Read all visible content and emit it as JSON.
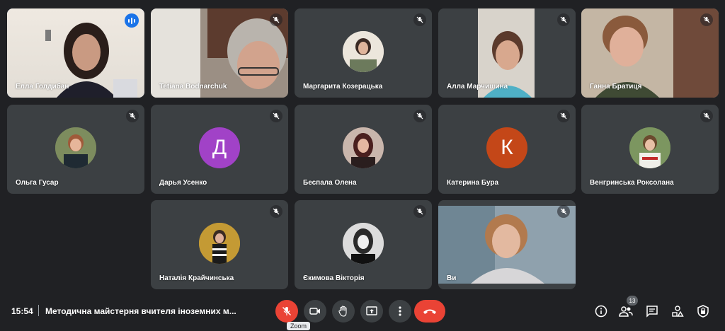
{
  "participants": [
    {
      "name": "Елла Голдибан",
      "type": "video",
      "speaking": true,
      "bg": "#e9e4dc"
    },
    {
      "name": "Tetiana Bodnarchuk",
      "type": "video",
      "bg": "#8d8b87"
    },
    {
      "name": "Маргарита Козерацька",
      "type": "photo",
      "bg": "#d8cfc0"
    },
    {
      "name": "Алла Марчишина",
      "type": "video",
      "bg": "#cfcac2"
    },
    {
      "name": "Ганна Братиця",
      "type": "video",
      "bg": "#b9ab98"
    },
    {
      "name": "Ольга Гусар",
      "type": "photo",
      "bg": "#6b7a53"
    },
    {
      "name": "Дарья Усенко",
      "type": "letter",
      "letter": "Д",
      "color": "#a142c7"
    },
    {
      "name": "Беспала Олена",
      "type": "photo",
      "bg": "#5b3b3b"
    },
    {
      "name": "Катерина Бура",
      "type": "letter",
      "letter": "К",
      "color": "#c44718"
    },
    {
      "name": "Венгринська Роксолана",
      "type": "photo",
      "bg": "#5f7a4a"
    },
    {
      "name": "Наталія Крайчинська",
      "type": "photo",
      "bg": "#b68c2d"
    },
    {
      "name": "Єкимова Вікторія",
      "type": "photo",
      "bg": "#8a8a8a"
    },
    {
      "name": "Ви",
      "type": "video",
      "bg": "#9aa7b0"
    }
  ],
  "footer": {
    "time": "15:54",
    "meeting_title": "Методична майстерня вчителя іноземних м...",
    "tooltip": "Zoom",
    "people_count": "13"
  },
  "icons": [
    "mic-off-icon",
    "camera-icon",
    "raise-hand-icon",
    "present-icon",
    "more-options-icon",
    "end-call-icon",
    "info-icon",
    "people-icon",
    "chat-icon",
    "activities-icon",
    "host-controls-icon"
  ],
  "colors": {
    "background": "#202124",
    "tile": "#3c4043",
    "danger": "#ea4335",
    "speaking": "#1a73e8"
  }
}
